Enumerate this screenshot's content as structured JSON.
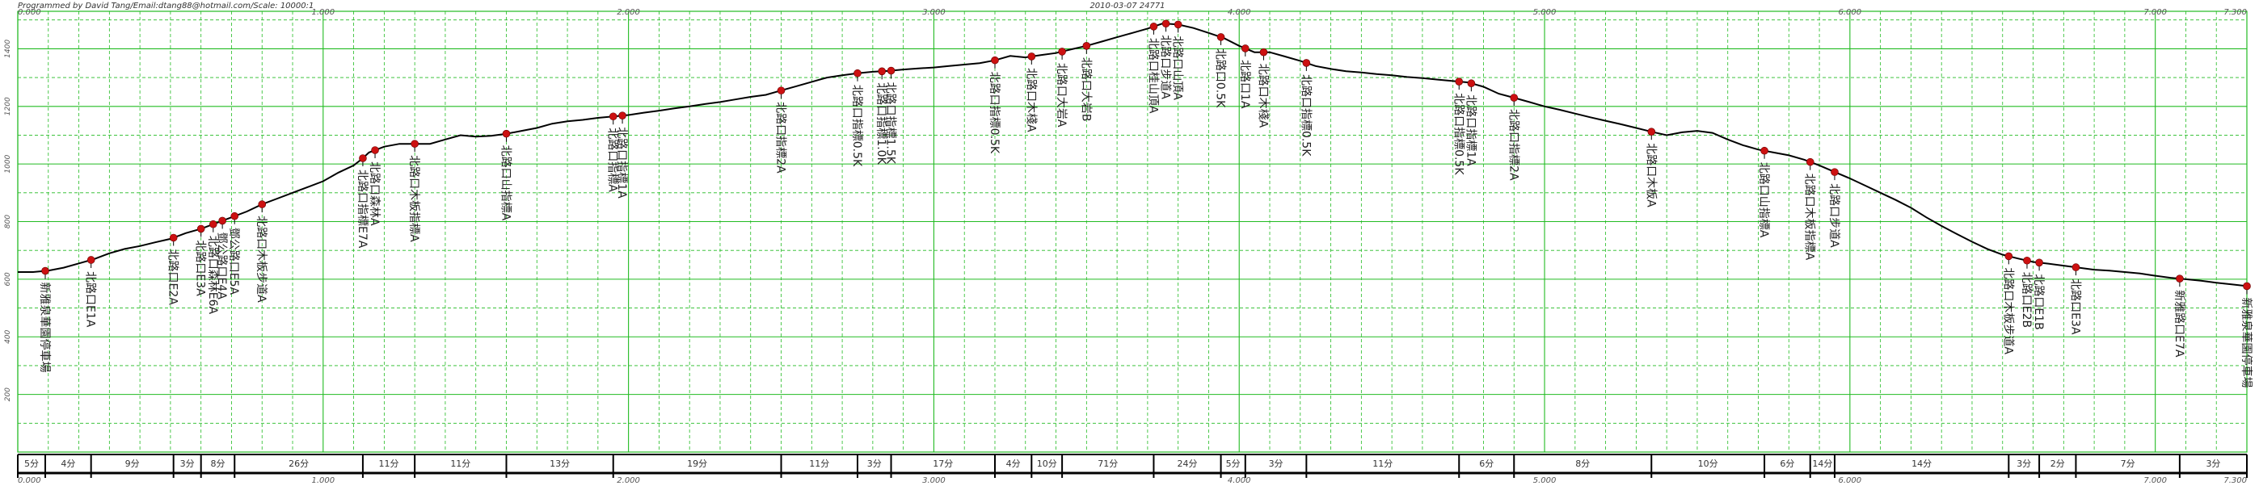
{
  "header": {
    "credit": "Programmed by David Tang/Email:dtang88@hotmail.com/Scale: 10000:1",
    "stamp": "2010-03-07 24771"
  },
  "chart_data": {
    "type": "line",
    "xlabel": "",
    "ylabel": "",
    "xlim": [
      0,
      7.3
    ],
    "ylim": [
      0,
      1530
    ],
    "x_ticks": [
      "0.000",
      "1.000",
      "2.000",
      "3.000",
      "4.000",
      "5.000",
      "6.000",
      "7.000",
      "7.300"
    ],
    "y_ticks": [
      {
        "value": 200,
        "label": "200"
      },
      {
        "value": 400,
        "label": "400"
      },
      {
        "value": 600,
        "label": "600"
      },
      {
        "value": 800,
        "label": "800"
      },
      {
        "value": 1000,
        "label": "1000"
      },
      {
        "value": 1200,
        "label": "1200"
      },
      {
        "value": 1400,
        "label": "1400"
      }
    ],
    "grid": true,
    "profile": {
      "x": [
        0,
        0.05,
        0.1,
        0.15,
        0.2,
        0.25,
        0.3,
        0.35,
        0.4,
        0.45,
        0.5,
        0.55,
        0.6,
        0.65,
        0.7,
        0.75,
        0.8,
        0.85,
        0.9,
        0.95,
        1.0,
        1.05,
        1.1,
        1.13,
        1.15,
        1.2,
        1.25,
        1.3,
        1.35,
        1.4,
        1.45,
        1.5,
        1.55,
        1.6,
        1.65,
        1.7,
        1.75,
        1.8,
        1.85,
        1.9,
        1.95,
        2.0,
        2.05,
        2.1,
        2.15,
        2.2,
        2.25,
        2.3,
        2.35,
        2.4,
        2.45,
        2.5,
        2.55,
        2.6,
        2.65,
        2.7,
        2.75,
        2.8,
        2.85,
        2.9,
        2.95,
        3.0,
        3.05,
        3.1,
        3.15,
        3.2,
        3.25,
        3.3,
        3.35,
        3.4,
        3.45,
        3.5,
        3.55,
        3.6,
        3.65,
        3.7,
        3.75,
        3.8,
        3.85,
        3.9,
        3.95,
        4.0,
        4.05,
        4.1,
        4.15,
        4.2,
        4.25,
        4.3,
        4.35,
        4.4,
        4.45,
        4.5,
        4.55,
        4.6,
        4.65,
        4.7,
        4.75,
        4.8,
        4.85,
        4.9,
        4.95,
        5.0,
        5.05,
        5.1,
        5.15,
        5.2,
        5.25,
        5.3,
        5.35,
        5.4,
        5.45,
        5.5,
        5.55,
        5.6,
        5.65,
        5.7,
        5.75,
        5.8,
        5.85,
        5.9,
        5.95,
        6.0,
        6.05,
        6.1,
        6.15,
        6.2,
        6.25,
        6.3,
        6.35,
        6.4,
        6.45,
        6.5,
        6.55,
        6.6,
        6.65,
        6.7,
        6.75,
        6.8,
        6.85,
        6.9,
        6.95,
        7.0,
        7.05,
        7.1,
        7.15,
        7.2,
        7.25,
        7.3
      ],
      "y": [
        625,
        625,
        630,
        640,
        655,
        670,
        690,
        705,
        715,
        728,
        740,
        760,
        775,
        795,
        815,
        835,
        860,
        880,
        900,
        920,
        940,
        970,
        995,
        1020,
        1040,
        1060,
        1070,
        1070,
        1070,
        1085,
        1100,
        1095,
        1098,
        1105,
        1115,
        1125,
        1140,
        1148,
        1153,
        1160,
        1165,
        1170,
        1178,
        1185,
        1193,
        1200,
        1208,
        1215,
        1224,
        1233,
        1240,
        1255,
        1270,
        1285,
        1300,
        1308,
        1315,
        1320,
        1323,
        1328,
        1332,
        1335,
        1340,
        1345,
        1350,
        1360,
        1375,
        1370,
        1378,
        1385,
        1398,
        1410,
        1425,
        1440,
        1455,
        1470,
        1488,
        1484,
        1472,
        1455,
        1437,
        1410,
        1388,
        1388,
        1373,
        1358,
        1340,
        1330,
        1322,
        1318,
        1312,
        1308,
        1302,
        1298,
        1293,
        1288,
        1283,
        1268,
        1244,
        1230,
        1215,
        1200,
        1188,
        1175,
        1162,
        1150,
        1138,
        1125,
        1112,
        1100,
        1110,
        1115,
        1108,
        1085,
        1065,
        1050,
        1040,
        1030,
        1015,
        995,
        972,
        950,
        925,
        900,
        875,
        848,
        815,
        785,
        757,
        730,
        705,
        685,
        672,
        660,
        654,
        647,
        640,
        633,
        630,
        625,
        620,
        612,
        605,
        600,
        595,
        588,
        582,
        576
      ]
    },
    "waypoints": [
      {
        "x": 0.09,
        "name": "新雅泉華園停車場"
      },
      {
        "x": 0.24,
        "name": "北路口E1A"
      },
      {
        "x": 0.51,
        "name": "北路口E2A"
      },
      {
        "x": 0.6,
        "name": "北路口E3A"
      },
      {
        "x": 0.64,
        "name": "北路口森林E6A"
      },
      {
        "x": 0.67,
        "name": "鄧公路口E4A"
      },
      {
        "x": 0.71,
        "name": "鄧公路口E5A"
      },
      {
        "x": 0.8,
        "name": "北路口木板步道A"
      },
      {
        "x": 1.13,
        "name": "北路口指標E7A"
      },
      {
        "x": 1.17,
        "name": "北路口森林A"
      },
      {
        "x": 1.3,
        "name": "北路口木板指標A"
      },
      {
        "x": 1.6,
        "name": "北路口山指標A"
      },
      {
        "x": 1.95,
        "name": "北路口指標A"
      },
      {
        "x": 1.98,
        "name": "北路口指標1A"
      },
      {
        "x": 2.5,
        "name": "北路口指標2A"
      },
      {
        "x": 2.75,
        "name": "北路口指標0.5K"
      },
      {
        "x": 2.83,
        "name": "北路口指標1.0K"
      },
      {
        "x": 2.86,
        "name": "北路口指標1.5K"
      },
      {
        "x": 3.2,
        "name": "北路口指標0.5K"
      },
      {
        "x": 3.32,
        "name": "北路口木棧A"
      },
      {
        "x": 3.42,
        "name": "北路口大岩A"
      },
      {
        "x": 3.5,
        "name": "北路口大岩B"
      },
      {
        "x": 3.72,
        "name": "北路口桂山頂A"
      },
      {
        "x": 3.76,
        "name": "北路口步道A"
      },
      {
        "x": 3.8,
        "name": "北路口山頂A"
      },
      {
        "x": 3.94,
        "name": "北路口0.5K"
      },
      {
        "x": 4.02,
        "name": "北路口1A"
      },
      {
        "x": 4.08,
        "name": "北路口木棧A"
      },
      {
        "x": 4.22,
        "name": "北路口指標0.5K"
      },
      {
        "x": 4.72,
        "name": "北路口指標0.5K"
      },
      {
        "x": 4.76,
        "name": "北路口指標1A"
      },
      {
        "x": 4.9,
        "name": "北路口指標2A"
      },
      {
        "x": 5.35,
        "name": "北路口木板A"
      },
      {
        "x": 5.72,
        "name": "北路口山指標A"
      },
      {
        "x": 5.87,
        "name": "北路口木板指標A"
      },
      {
        "x": 5.95,
        "name": "北路口步道A"
      },
      {
        "x": 6.52,
        "name": "北路口木板步道A"
      },
      {
        "x": 6.58,
        "name": "北路口E2B"
      },
      {
        "x": 6.62,
        "name": "北路口E1B"
      },
      {
        "x": 6.74,
        "name": "北路口E3A"
      },
      {
        "x": 7.08,
        "name": "新雅路口E7A"
      },
      {
        "x": 7.3,
        "name": "新雅泉華園停車場"
      }
    ],
    "segments": [
      {
        "x0": 0.0,
        "x1": 0.09,
        "label": "5分"
      },
      {
        "x0": 0.09,
        "x1": 0.24,
        "label": "4分"
      },
      {
        "x0": 0.24,
        "x1": 0.51,
        "label": "9分"
      },
      {
        "x0": 0.51,
        "x1": 0.6,
        "label": "3分"
      },
      {
        "x0": 0.6,
        "x1": 0.71,
        "label": "8分"
      },
      {
        "x0": 0.71,
        "x1": 1.13,
        "label": "26分"
      },
      {
        "x0": 1.13,
        "x1": 1.3,
        "label": "11分"
      },
      {
        "x0": 1.3,
        "x1": 1.6,
        "label": "11分"
      },
      {
        "x0": 1.6,
        "x1": 1.95,
        "label": "13分"
      },
      {
        "x0": 1.95,
        "x1": 2.5,
        "label": "19分"
      },
      {
        "x0": 2.5,
        "x1": 2.75,
        "label": "11分"
      },
      {
        "x0": 2.75,
        "x1": 2.86,
        "label": "3分"
      },
      {
        "x0": 2.86,
        "x1": 3.2,
        "label": "17分"
      },
      {
        "x0": 3.2,
        "x1": 3.32,
        "label": "4分"
      },
      {
        "x0": 3.32,
        "x1": 3.42,
        "label": "10分"
      },
      {
        "x0": 3.42,
        "x1": 3.72,
        "label": "71分"
      },
      {
        "x0": 3.72,
        "x1": 3.94,
        "label": "24分"
      },
      {
        "x0": 3.94,
        "x1": 4.02,
        "label": "5分"
      },
      {
        "x0": 4.02,
        "x1": 4.22,
        "label": "3分"
      },
      {
        "x0": 4.22,
        "x1": 4.72,
        "label": "11分"
      },
      {
        "x0": 4.72,
        "x1": 4.9,
        "label": "6分"
      },
      {
        "x0": 4.9,
        "x1": 5.35,
        "label": "8分"
      },
      {
        "x0": 5.35,
        "x1": 5.72,
        "label": "10分"
      },
      {
        "x0": 5.72,
        "x1": 5.87,
        "label": "6分"
      },
      {
        "x0": 5.87,
        "x1": 5.95,
        "label": "14分"
      },
      {
        "x0": 5.95,
        "x1": 6.52,
        "label": "14分"
      },
      {
        "x0": 6.52,
        "x1": 6.62,
        "label": "3分"
      },
      {
        "x0": 6.62,
        "x1": 6.74,
        "label": "2分"
      },
      {
        "x0": 6.74,
        "x1": 7.08,
        "label": "7分"
      },
      {
        "x0": 7.08,
        "x1": 7.3,
        "label": "3分"
      }
    ]
  },
  "colors": {
    "grid": "#22bb22",
    "profile": "#000000",
    "marker": "#cc1111",
    "axis": "#000000"
  }
}
